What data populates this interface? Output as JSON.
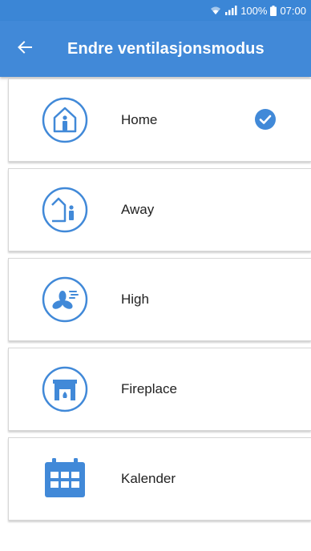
{
  "status_bar": {
    "battery": "100%",
    "time": "07:00"
  },
  "header": {
    "title": "Endre ventilasjonsmodus",
    "back_icon": "arrow-left-icon"
  },
  "modes": [
    {
      "label": "Home",
      "icon": "home-icon",
      "selected": true
    },
    {
      "label": "Away",
      "icon": "away-icon",
      "selected": false
    },
    {
      "label": "High",
      "icon": "fan-icon",
      "selected": false
    },
    {
      "label": "Fireplace",
      "icon": "fireplace-icon",
      "selected": false
    },
    {
      "label": "Kalender",
      "icon": "calendar-icon",
      "selected": false
    }
  ],
  "colors": {
    "accent": "#4189d8",
    "status_bar": "#3b86d6",
    "card_border": "#d7d7d7"
  }
}
